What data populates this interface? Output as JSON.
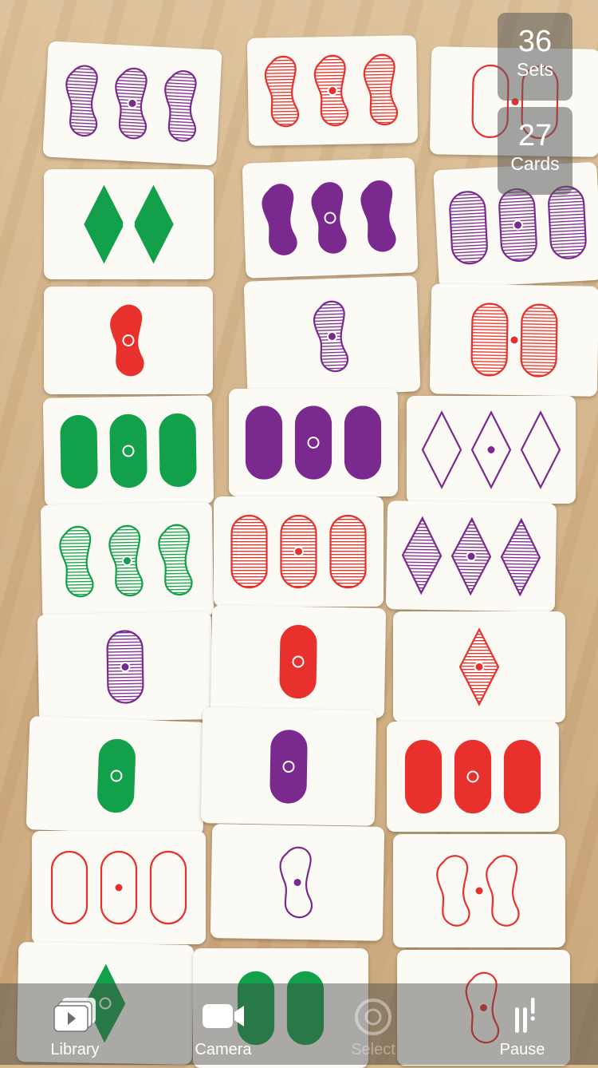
{
  "stats": {
    "sets": {
      "value": "36",
      "label": "Sets"
    },
    "cards": {
      "value": "27",
      "label": "Cards"
    }
  },
  "toolbar": {
    "library": "Library",
    "camera": "Camera",
    "select": "Select",
    "pause": "Pause"
  },
  "colors": {
    "red": "#e8302d",
    "green": "#12a04a",
    "purple": "#7a2a8e"
  },
  "cards": [
    {
      "count": 3,
      "shape": "squiggle",
      "color": "purple",
      "fill": "striped"
    },
    {
      "count": 3,
      "shape": "squiggle",
      "color": "red",
      "fill": "striped"
    },
    {
      "count": 2,
      "shape": "oval",
      "color": "red",
      "fill": "open"
    },
    {
      "count": 2,
      "shape": "diamond",
      "color": "green",
      "fill": "solid"
    },
    {
      "count": 3,
      "shape": "squiggle",
      "color": "purple",
      "fill": "solid"
    },
    {
      "count": 3,
      "shape": "oval",
      "color": "purple",
      "fill": "striped"
    },
    {
      "count": 1,
      "shape": "squiggle",
      "color": "red",
      "fill": "solid"
    },
    {
      "count": 1,
      "shape": "squiggle",
      "color": "purple",
      "fill": "striped"
    },
    {
      "count": 2,
      "shape": "oval",
      "color": "red",
      "fill": "striped"
    },
    {
      "count": 3,
      "shape": "oval",
      "color": "green",
      "fill": "solid"
    },
    {
      "count": 3,
      "shape": "oval",
      "color": "purple",
      "fill": "solid"
    },
    {
      "count": 3,
      "shape": "diamond",
      "color": "purple",
      "fill": "open"
    },
    {
      "count": 3,
      "shape": "squiggle",
      "color": "green",
      "fill": "striped"
    },
    {
      "count": 3,
      "shape": "oval",
      "color": "red",
      "fill": "striped"
    },
    {
      "count": 3,
      "shape": "diamond",
      "color": "purple",
      "fill": "striped"
    },
    {
      "count": 1,
      "shape": "oval",
      "color": "purple",
      "fill": "striped"
    },
    {
      "count": 1,
      "shape": "oval",
      "color": "red",
      "fill": "solid"
    },
    {
      "count": 1,
      "shape": "diamond",
      "color": "red",
      "fill": "striped"
    },
    {
      "count": 1,
      "shape": "oval",
      "color": "green",
      "fill": "solid"
    },
    {
      "count": 1,
      "shape": "oval",
      "color": "purple",
      "fill": "solid"
    },
    {
      "count": 3,
      "shape": "oval",
      "color": "red",
      "fill": "solid"
    },
    {
      "count": 3,
      "shape": "oval",
      "color": "red",
      "fill": "open"
    },
    {
      "count": 1,
      "shape": "squiggle",
      "color": "purple",
      "fill": "open"
    },
    {
      "count": 2,
      "shape": "squiggle",
      "color": "red",
      "fill": "open"
    },
    {
      "count": 1,
      "shape": "diamond",
      "color": "green",
      "fill": "solid"
    },
    {
      "count": 2,
      "shape": "oval",
      "color": "green",
      "fill": "solid"
    },
    {
      "count": 1,
      "shape": "squiggle",
      "color": "red",
      "fill": "open"
    }
  ]
}
